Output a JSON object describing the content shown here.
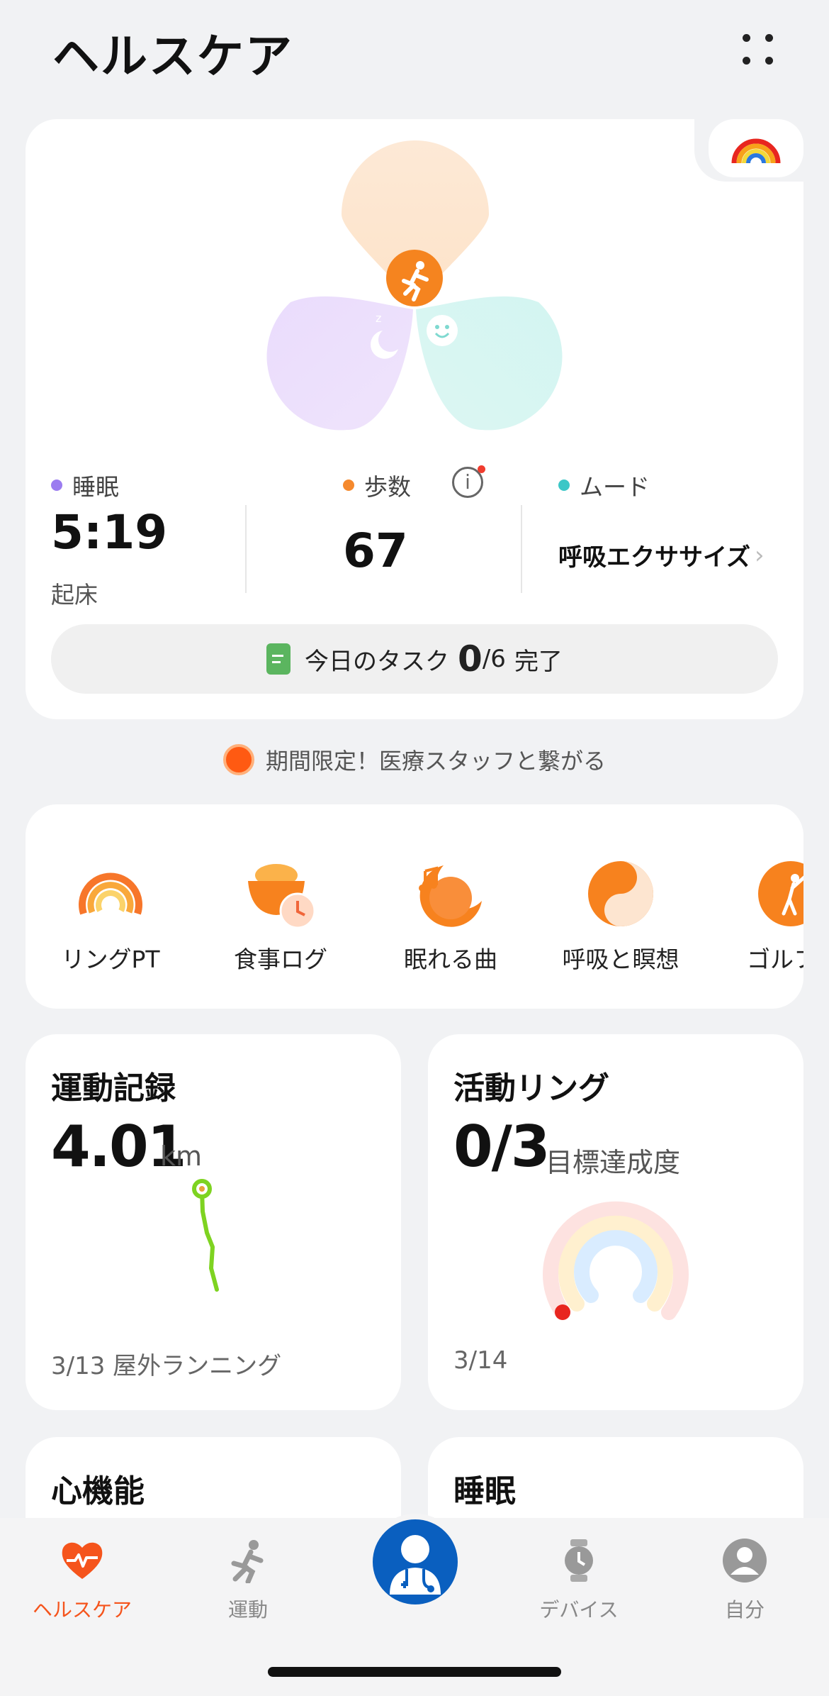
{
  "header": {
    "title": "ヘルスケア"
  },
  "summary": {
    "sleep": {
      "label": "睡眠",
      "value": "5:19",
      "sub": "起床",
      "color": "#9b7cf0"
    },
    "steps": {
      "label": "歩数",
      "value": "67",
      "color": "#f5892d"
    },
    "mood": {
      "label": "ムード",
      "action": "呼吸エクササイズ",
      "color": "#3cc7c7"
    },
    "task": {
      "prefix": "今日のタスク",
      "done": "0",
      "total": "/6",
      "suffix": "完了"
    }
  },
  "promo": {
    "text": "期間限定！医療スタッフと繋がる"
  },
  "shortcuts": [
    {
      "label": "リングPT",
      "icon": "ring-pt-icon"
    },
    {
      "label": "食事ログ",
      "icon": "meal-log-icon"
    },
    {
      "label": "眠れる曲",
      "icon": "sleep-music-icon"
    },
    {
      "label": "呼吸と瞑想",
      "icon": "breathing-icon"
    },
    {
      "label": "ゴルフ",
      "icon": "golf-icon"
    }
  ],
  "exercise": {
    "title": "運動記録",
    "value": "4.01",
    "unit": "km",
    "foot": "3/13 屋外ランニング"
  },
  "rings": {
    "title": "活動リング",
    "value": "0/3",
    "unit": "目標達成度",
    "foot": "3/14",
    "progress": 0
  },
  "cards_below": {
    "heart": "心機能",
    "sleep": "睡眠"
  },
  "nav": [
    {
      "label": "ヘルスケア",
      "icon": "heart-pulse-icon",
      "active": true
    },
    {
      "label": "運動",
      "icon": "runner-icon",
      "active": false
    },
    {
      "label": "",
      "icon": "doctor-icon",
      "active": false
    },
    {
      "label": "デバイス",
      "icon": "watch-icon",
      "active": false
    },
    {
      "label": "自分",
      "icon": "profile-icon",
      "active": false
    }
  ],
  "colors": {
    "accent": "#f5541c",
    "fab": "#0a5fbf"
  }
}
